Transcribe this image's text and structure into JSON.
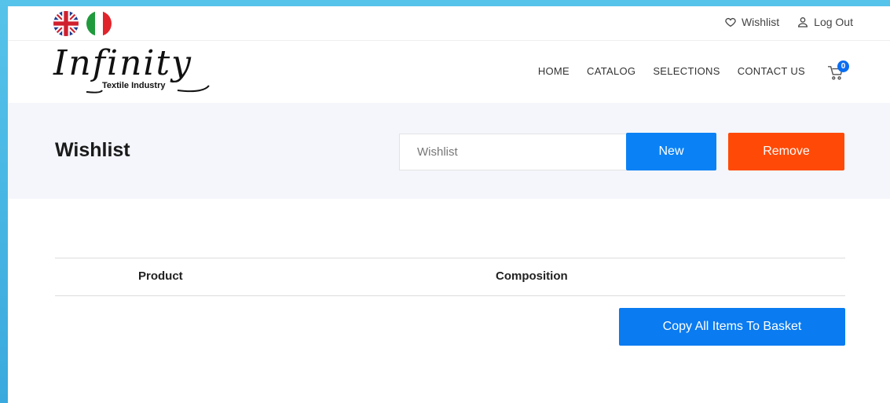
{
  "topbar": {
    "languages": [
      "uk-flag-icon",
      "italy-flag-icon"
    ],
    "wishlist_link": "Wishlist",
    "logout_link": "Log Out"
  },
  "header": {
    "logo_main": "Infinity",
    "logo_sub": "Textile Industry",
    "nav": [
      "HOME",
      "CATALOG",
      "SELECTIONS",
      "CONTACT US"
    ],
    "cart_count": "0"
  },
  "wishlist": {
    "title": "Wishlist",
    "input_placeholder": "Wishlist",
    "input_value": "",
    "new_button": "New",
    "remove_button": "Remove"
  },
  "table": {
    "columns": [
      "Product",
      "Composition"
    ],
    "rows": []
  },
  "actions": {
    "copy_button": "Copy All Items To Basket"
  },
  "colors": {
    "accent_blue": "#0a82f5",
    "remove_orange": "#ff4a07",
    "band_bg": "#f4f6fb"
  }
}
